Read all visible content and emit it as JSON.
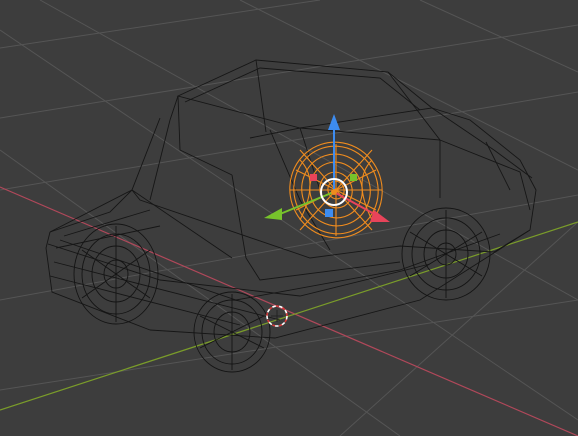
{
  "viewport": {
    "mode": "wireframe",
    "background": "#3d3d3d",
    "grid_color": "#555555",
    "x_axis_color": "#b0485a",
    "y_axis_color": "#7a9c2a"
  },
  "scene": {
    "object": "car",
    "object_wire_color": "#141414",
    "selected_object": "wheel",
    "selection_color": "#f08c1e"
  },
  "gizmo": {
    "type": "translate",
    "z_color": "#3d8cf0",
    "x_color": "#e8445a",
    "y_color": "#77c32b",
    "center_color": "#ffffff"
  },
  "cursor_3d": {
    "ring_colors": [
      "#ffffff",
      "#d93a3a"
    ]
  }
}
